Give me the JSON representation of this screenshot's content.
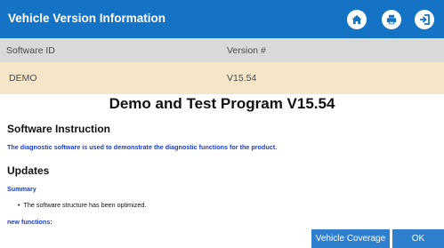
{
  "window": {
    "title": "Vehicle Version Information"
  },
  "toolbar": {
    "icons": [
      "home-icon",
      "print-icon",
      "exit-icon"
    ]
  },
  "table": {
    "headers": [
      "Software ID",
      "Version #"
    ],
    "rows": [
      [
        "DEMO",
        "V15.54"
      ]
    ]
  },
  "content": {
    "title": "Demo and Test Program V15.54",
    "software_instruction": {
      "heading": "Software Instruction",
      "text": "The diagnostic software is used to demonstrate the diagnostic functions for the product."
    },
    "updates": {
      "heading": "Updates",
      "summary_label": "Summary",
      "bullet": "The software structure has been optimized.",
      "new_functions_label": "new functions:"
    }
  },
  "buttons": {
    "vehicle_coverage": "Vehicle Coverage",
    "ok": "OK"
  },
  "colors": {
    "titlebar": "#1573c6",
    "header_row": "#d9d9d9",
    "data_row": "#f5e6c8",
    "button": "#2f7fcf",
    "link_text": "#1a3fc4"
  }
}
